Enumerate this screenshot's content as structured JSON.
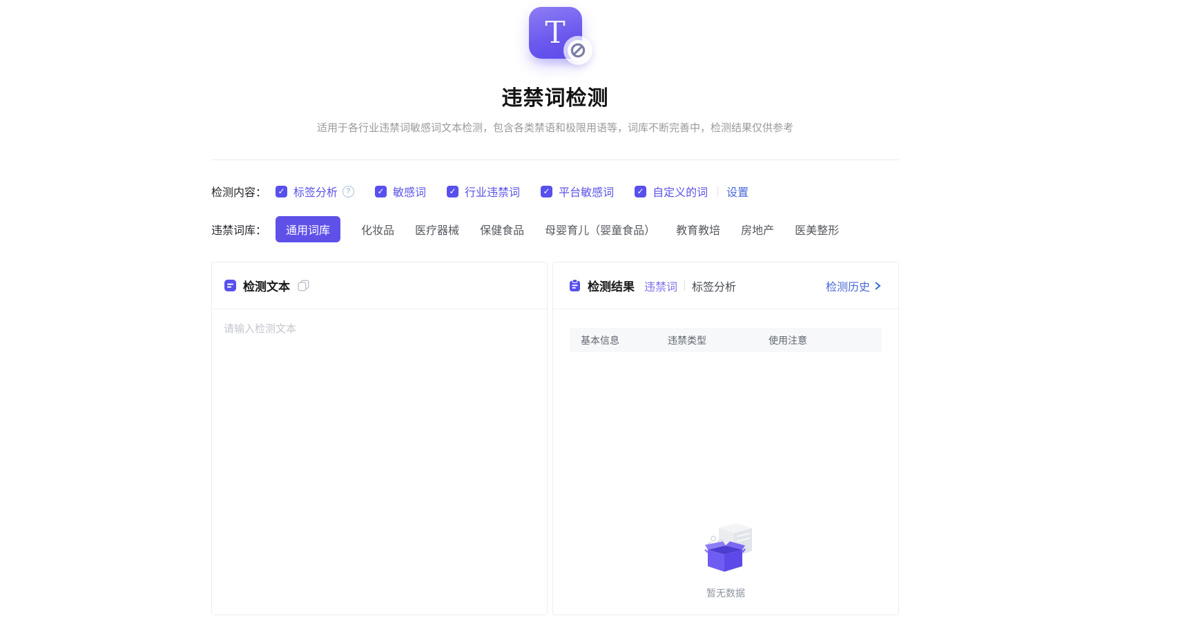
{
  "colors": {
    "primary": "#5850EC",
    "button": "#5F51E8",
    "link": "#4A68D8",
    "active_tab": "#7B71EA"
  },
  "hero": {
    "logo_letter": "T",
    "title": "违禁词检测",
    "subtitle": "适用于各行业违禁词敏感词文本检测，包含各类禁语和极限用语等，词库不断完善中，检测结果仅供参考"
  },
  "detect_content": {
    "label": "检测内容：",
    "options": [
      {
        "label": "标签分析",
        "checked": true,
        "has_help": true
      },
      {
        "label": "敏感词",
        "checked": true
      },
      {
        "label": "行业违禁词",
        "checked": true
      },
      {
        "label": "平台敏感词",
        "checked": true
      },
      {
        "label": "自定义的词",
        "checked": true
      }
    ],
    "settings_label": "设置"
  },
  "library": {
    "label": "违禁词库：",
    "active": "通用词库",
    "tabs": [
      {
        "label": "通用词库"
      },
      {
        "label": "化妆品"
      },
      {
        "label": "医疗器械"
      },
      {
        "label": "保健食品"
      },
      {
        "label": "母婴育儿（婴童食品）"
      },
      {
        "label": "教育教培"
      },
      {
        "label": "房地产"
      },
      {
        "label": "医美整形"
      }
    ]
  },
  "input_panel": {
    "title": "检测文本",
    "placeholder": "请输入检测文本",
    "text_value": ""
  },
  "result_panel": {
    "title": "检测结果",
    "tabs": [
      {
        "label": "违禁词"
      },
      {
        "label": "标签分析"
      }
    ],
    "active_tab": "违禁词",
    "history_label": "检测历史",
    "columns": [
      {
        "label": "基本信息"
      },
      {
        "label": "违禁类型"
      },
      {
        "label": "使用注意"
      }
    ],
    "rows": [],
    "empty_text": "暂无数据"
  }
}
